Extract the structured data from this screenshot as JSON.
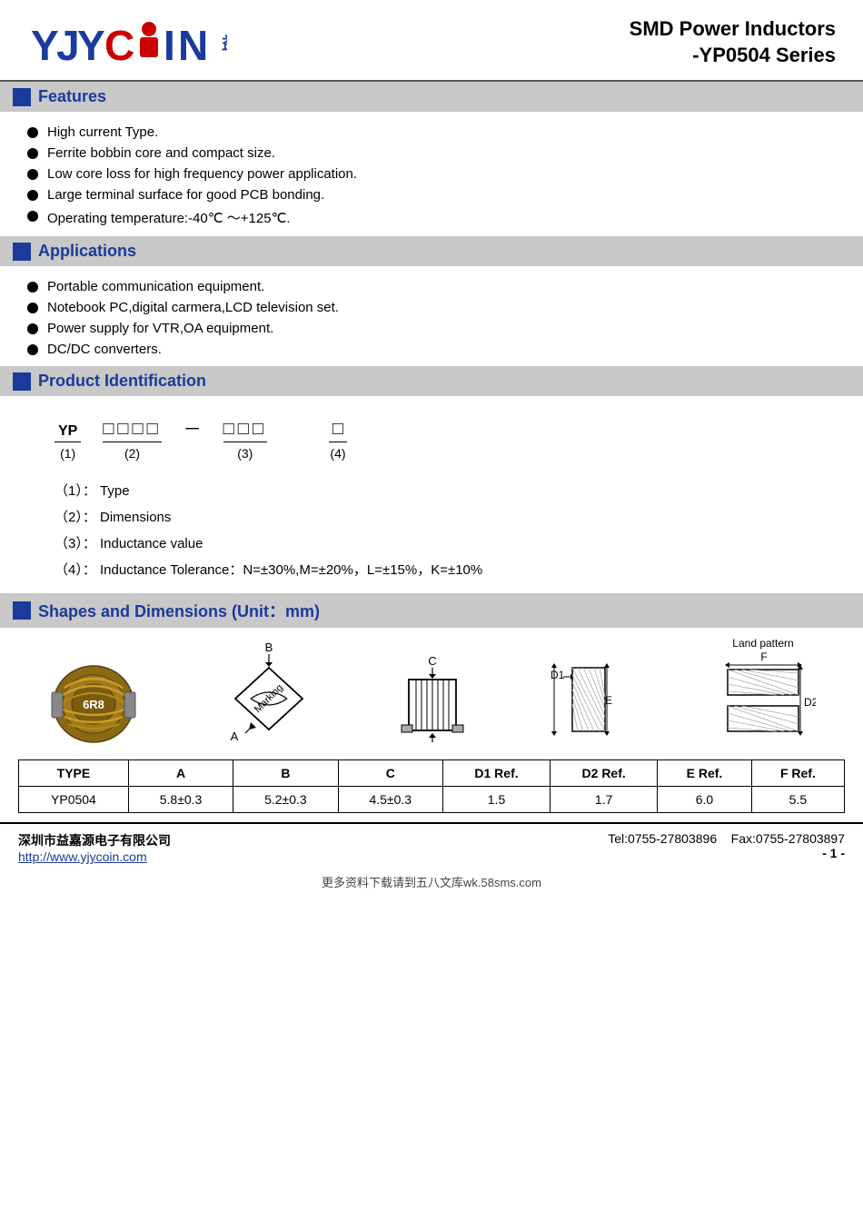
{
  "header": {
    "logo_yjy": "YJYCOIN",
    "logo_chinese": "益嘉源",
    "product_title_line1": "SMD Power Inductors",
    "product_title_line2": "-YP0504 Series"
  },
  "sections": {
    "features": {
      "title": "Features",
      "items": [
        "High current Type.",
        "Ferrite bobbin core and compact size.",
        "Low core loss for high frequency power application.",
        "Large terminal surface for good PCB bonding.",
        "Operating temperature:-40℃ ～+125℃."
      ]
    },
    "applications": {
      "title": "Applications",
      "items": [
        "Portable communication equipment.",
        "Notebook PC,digital carmera,LCD television set.",
        "Power supply for VTR,OA equipment.",
        "DC/DC converters."
      ]
    },
    "product_id": {
      "title": "Product Identification",
      "diagram_prefix": "YP",
      "diagram_prefix_label": "(1)",
      "diagram_boxes1": "□□□□",
      "diagram_dash": "－",
      "diagram_boxes2": "□□□",
      "diagram_label2": "(2)",
      "diagram_label3": "(3)",
      "diagram_box4": "□",
      "diagram_label4": "(4)",
      "legend": [
        {
          "num": "（1）：",
          "text": "Type"
        },
        {
          "num": "（2）：",
          "text": "Dimensions"
        },
        {
          "num": "（3）：",
          "text": "Inductance value"
        },
        {
          "num": "（4）：",
          "text": "Inductance Tolerance：N=±30%,M=±20%，L=±15%，K=±10%"
        }
      ]
    },
    "shapes": {
      "title": "Shapes and Dimensions (Unit：mm)",
      "land_pattern_label": "Land pattern",
      "table": {
        "headers": [
          "TYPE",
          "A",
          "B",
          "C",
          "D1 Ref.",
          "D2 Ref.",
          "E Ref.",
          "F Ref."
        ],
        "rows": [
          [
            "YP0504",
            "5.8±0.3",
            "5.2±0.3",
            "4.5±0.3",
            "1.5",
            "1.7",
            "6.0",
            "5.5"
          ]
        ]
      }
    }
  },
  "footer": {
    "company": "深圳市益嘉源电子有限公司",
    "url": "http://www.yjycoin.com",
    "tel": "Tel:0755-27803896",
    "fax": "Fax:0755-27803897",
    "page": "- 1 -"
  },
  "bottom_notice": "更多资料下载请到五八文库wk.58sms.com"
}
